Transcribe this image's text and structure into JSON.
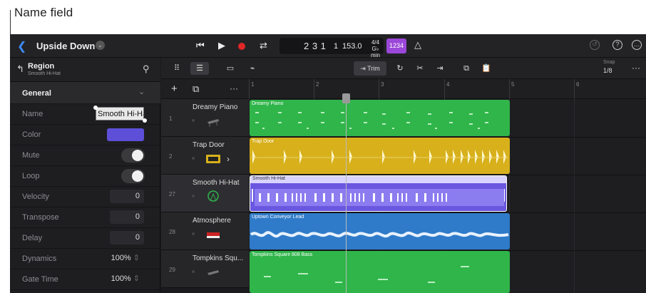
{
  "callout": {
    "text": "Name field"
  },
  "topbar": {
    "project_name": "Upside Down 2",
    "position": "2 3 1",
    "beat": "1",
    "tempo": "153.0",
    "time_sig_top": "4/4",
    "time_sig_bottom": "G♭ min",
    "count_in": "1234"
  },
  "inspector": {
    "region_title": "Region",
    "region_subtitle": "Smooth Hi-Hat",
    "section_title": "General",
    "rows": {
      "name_label": "Name",
      "name_value": "Smooth Hi-Hat",
      "color_label": "Color",
      "color_value": "#5d4fd8",
      "mute_label": "Mute",
      "loop_label": "Loop",
      "velocity_label": "Velocity",
      "velocity_value": "0",
      "transpose_label": "Transpose",
      "transpose_value": "0",
      "delay_label": "Delay",
      "delay_value": "0",
      "dynamics_label": "Dynamics",
      "dynamics_value": "100%",
      "gatetime_label": "Gate Time",
      "gatetime_value": "100%"
    }
  },
  "toolbar": {
    "trim_label": "Trim",
    "snap_label": "Snap",
    "snap_value": "1/8"
  },
  "ruler": {
    "bars": [
      "1",
      "2",
      "3",
      "4",
      "5",
      "6"
    ]
  },
  "tracks": [
    {
      "number": "1",
      "name": "Dreamy Piano",
      "region": "Dreamy Piano",
      "color": "#2fb54a"
    },
    {
      "number": "2",
      "name": "Trap Door",
      "region": "Trap Door",
      "color": "#d7b01c"
    },
    {
      "number": "27",
      "name": "Smooth Hi-Hat",
      "region": "Smooth Hi-Hat",
      "color": "#6a57e0"
    },
    {
      "number": "28",
      "name": "Atmosphere",
      "region": "Uptown Conveyor Lead",
      "color": "#2f7bc9"
    },
    {
      "number": "29",
      "name": "Tompkins Squ...",
      "region": "Tompkins Square 808 Bass",
      "color": "#2fb54a"
    }
  ]
}
